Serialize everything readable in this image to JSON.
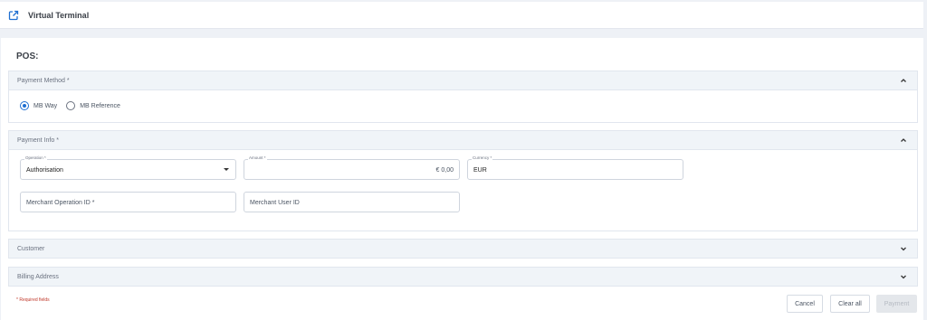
{
  "header": {
    "title": "Virtual Terminal",
    "icon": "external-link-icon"
  },
  "page": {
    "title": "POS:"
  },
  "payment_method": {
    "header": "Payment Method *",
    "options": [
      {
        "label": "MB Way",
        "checked": true
      },
      {
        "label": "MB Reference",
        "checked": false
      }
    ]
  },
  "payment_info": {
    "header": "Payment Info *",
    "operation": {
      "label": "Operation *",
      "value": "Authorisation"
    },
    "amount": {
      "label": "Amount *",
      "value": "€ 0,00"
    },
    "currency": {
      "label": "Currency *",
      "value": "EUR"
    },
    "merchant_operation_id": {
      "placeholder": "Merchant Operation ID *"
    },
    "merchant_user_id": {
      "placeholder": "Merchant User ID"
    }
  },
  "customer": {
    "header": "Customer"
  },
  "billing_address": {
    "header": "Billing Address"
  },
  "footer": {
    "required_note": "* Required fields",
    "cancel_label": "Cancel",
    "clear_label": "Clear all",
    "payment_label": "Payment"
  },
  "colors": {
    "accent": "#1f6fd1",
    "required": "#c0392b",
    "section_header_bg": "#f0f4f8"
  }
}
